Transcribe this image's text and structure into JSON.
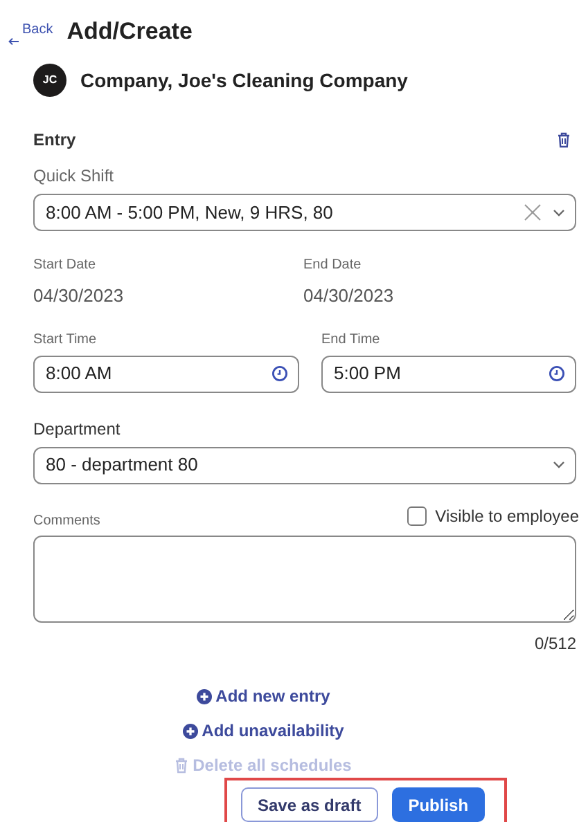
{
  "header": {
    "back": "Back",
    "title": "Add/Create"
  },
  "company": {
    "initials": "JC",
    "name": "Company, Joe's Cleaning Company"
  },
  "entry": {
    "heading": "Entry",
    "quick_shift": {
      "label": "Quick Shift",
      "value": "8:00 AM - 5:00 PM, New, 9 HRS, 80"
    },
    "start_date": {
      "label": "Start Date",
      "value": "04/30/2023"
    },
    "end_date": {
      "label": "End Date",
      "value": "04/30/2023"
    },
    "start_time": {
      "label": "Start Time",
      "value": "8:00 AM"
    },
    "end_time": {
      "label": "End Time",
      "value": "5:00 PM"
    },
    "department": {
      "label": "Department",
      "value": "80 - department 80"
    },
    "comments": {
      "label": "Comments",
      "counter": "0/512"
    },
    "visible_to_employee": {
      "label": "Visible to employee",
      "checked": false
    }
  },
  "actions": [
    {
      "label": "Add new entry",
      "kind": "add",
      "disabled": false
    },
    {
      "label": "Add unavailability",
      "kind": "add",
      "disabled": false
    },
    {
      "label": "Delete all schedules",
      "kind": "delete",
      "disabled": true
    }
  ],
  "buttons": [
    {
      "label": "Save as draft",
      "kind": "secondary"
    },
    {
      "label": "Publish",
      "kind": "primary"
    }
  ]
}
